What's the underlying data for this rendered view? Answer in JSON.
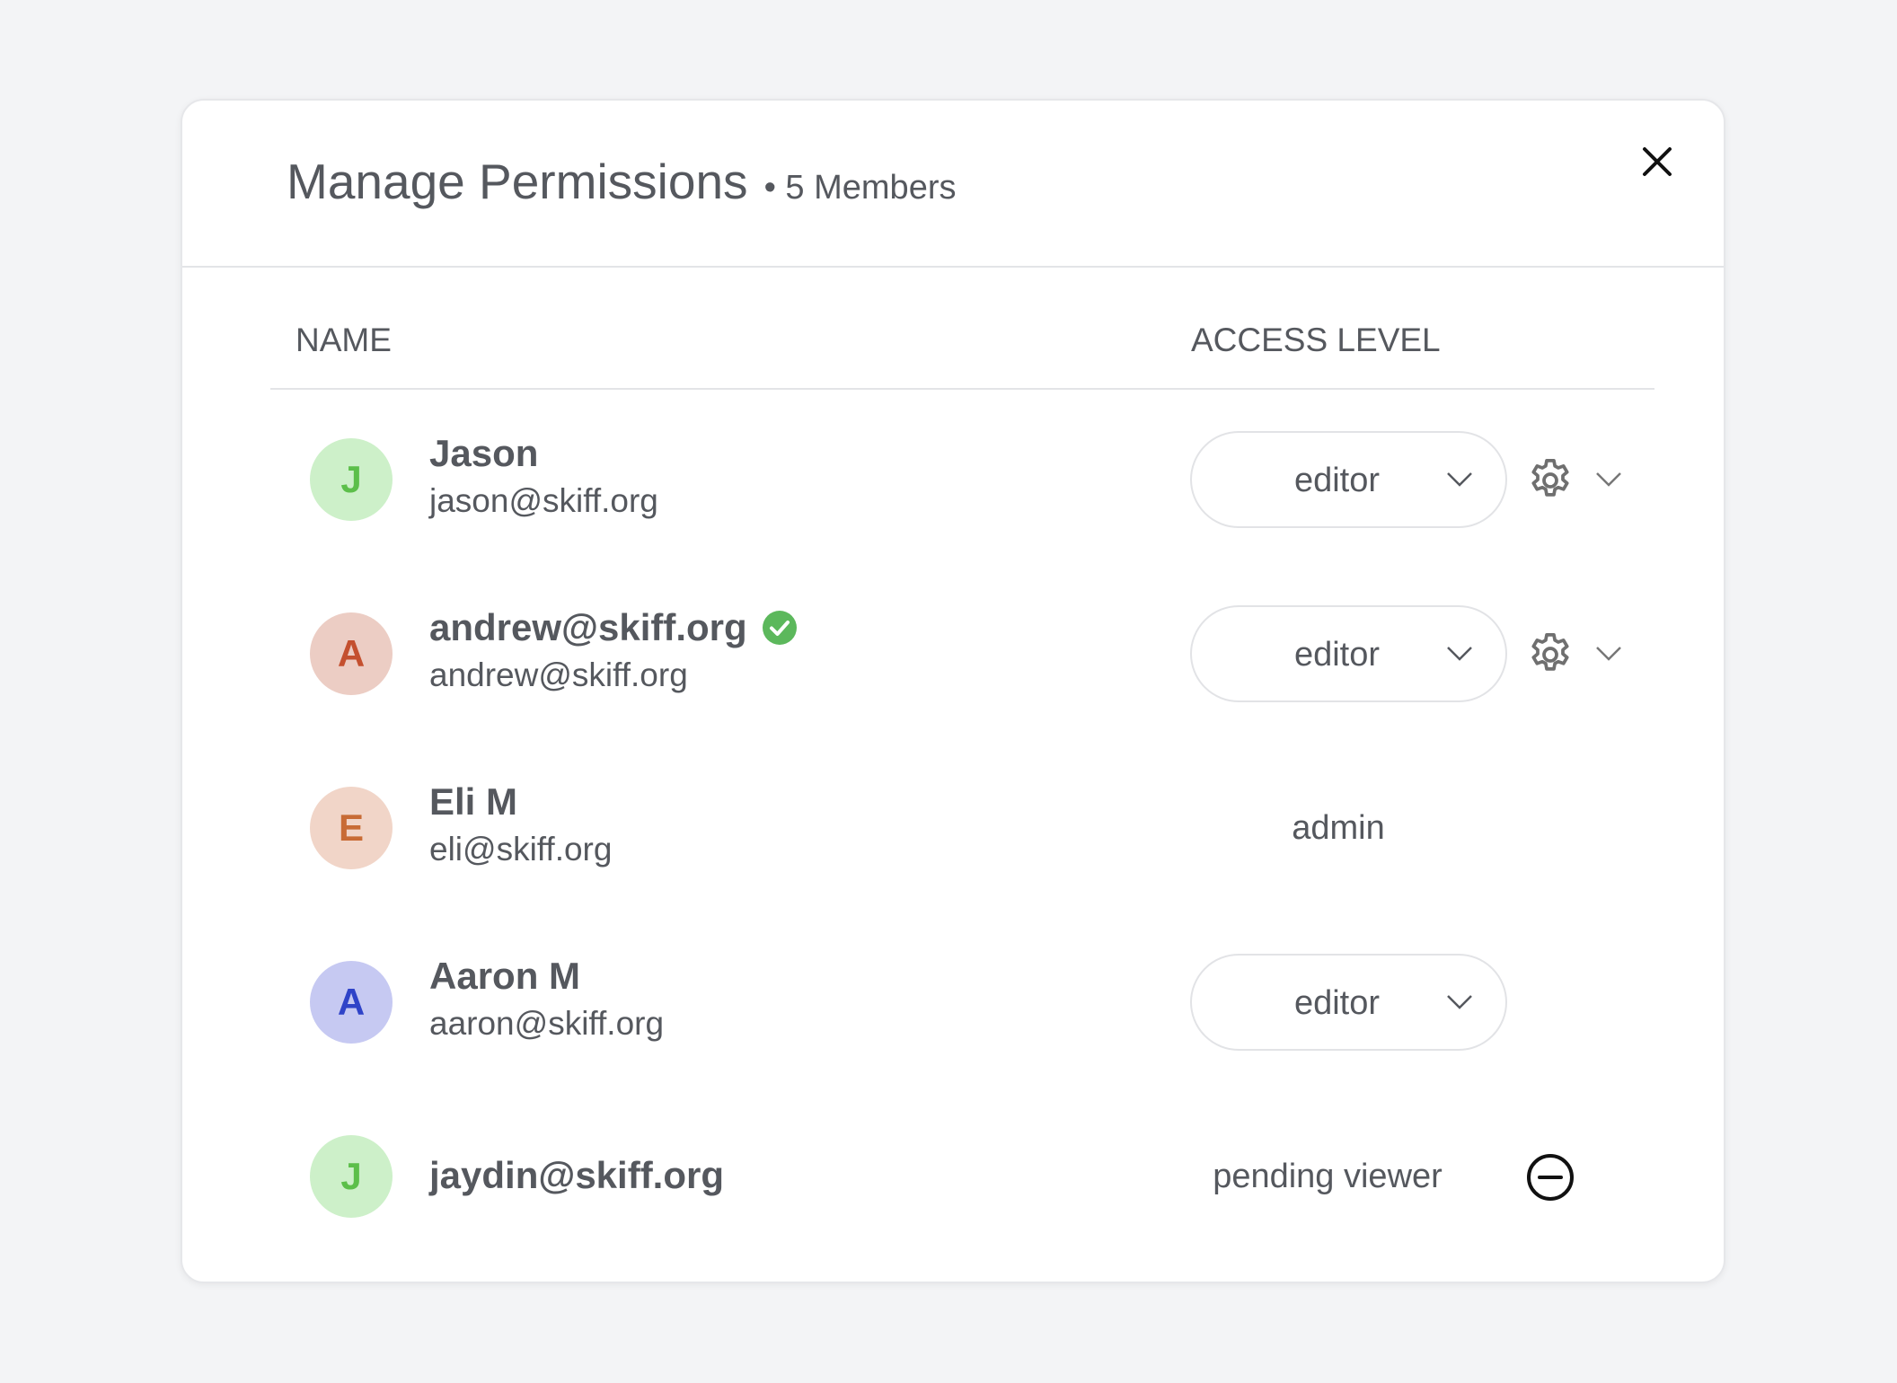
{
  "dialog": {
    "title": "Manage Permissions",
    "member_count": "• 5 Members",
    "close_icon": "close-icon"
  },
  "table": {
    "col_name": "NAME",
    "col_access": "ACCESS LEVEL"
  },
  "members": [
    {
      "initial": "J",
      "name": "Jason",
      "email": "jason@skiff.org",
      "access": "editor",
      "avatar_bg": "#cdf0c9",
      "avatar_fg": "#5cbf4a"
    },
    {
      "initial": "A",
      "name": "andrew@skiff.org",
      "email": "andrew@skiff.org",
      "verified": true,
      "access": "editor",
      "avatar_bg": "#eccdc4",
      "avatar_fg": "#c4502f"
    },
    {
      "initial": "E",
      "name": "Eli M",
      "email": "eli@skiff.org",
      "access": "admin",
      "avatar_bg": "#f1d5c8",
      "avatar_fg": "#c86b35"
    },
    {
      "initial": "A",
      "name": "Aaron M",
      "email": "aaron@skiff.org",
      "access": "editor",
      "avatar_bg": "#c6c9f2",
      "avatar_fg": "#2f43c8"
    },
    {
      "initial": "J",
      "name": "jaydin@skiff.org",
      "access": "pending viewer",
      "avatar_bg": "#cdf0c9",
      "avatar_fg": "#5cbf4a"
    }
  ],
  "colors": {
    "verified": "#5cb85c",
    "background": "#f3f4f6"
  }
}
